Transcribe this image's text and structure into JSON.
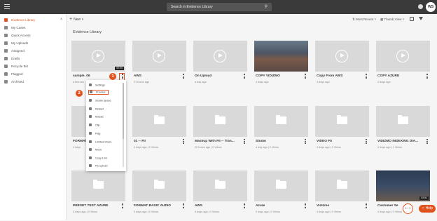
{
  "topbar": {
    "search_placeholder": "Search in Evidence Library",
    "avatar_initials": "WS"
  },
  "sidebar": {
    "items": [
      {
        "label": "Evidence Library",
        "active": true
      },
      {
        "label": "My Cases"
      },
      {
        "label": "Quick Access"
      },
      {
        "label": "My Uploads"
      },
      {
        "label": "Assigned"
      },
      {
        "label": "Drafts"
      },
      {
        "label": "Recycle Bin"
      },
      {
        "label": "Flagged"
      },
      {
        "label": "Archived"
      }
    ]
  },
  "toolbar": {
    "new_label": "New",
    "sort_label": "Most Recent",
    "view_label": "Thumb View"
  },
  "page_title": "Evidence Library",
  "cards": [
    {
      "title": "sample_06",
      "meta": "a few sec",
      "duration": "00:00"
    },
    {
      "title": "AWS",
      "meta": "21 hours ago"
    },
    {
      "title": "On Upload",
      "meta": "a day ago"
    },
    {
      "title": "COPY VIDIZMO",
      "meta": "4 days ago"
    },
    {
      "title": "Copy From AWS",
      "meta": "4 days ago"
    },
    {
      "title": "COPY AZURE",
      "meta": "4 days ago"
    },
    {
      "title": "FORMAT",
      "meta": "4 days"
    },
    {
      "title": "01 -- FII",
      "meta": "4 days ago | 0 Views"
    },
    {
      "title": "Mashup With FII -- Tran...",
      "meta": "20 hours ago | 0 Views"
    },
    {
      "title": "Studio",
      "meta": "a day ago | 0 Views"
    },
    {
      "title": "VIDEO FII",
      "meta": "4 days ago | 0 Views"
    },
    {
      "title": "VIDIZMO INDEXING DIA...",
      "meta": "4 days ago | 1 Views"
    },
    {
      "title": "PRESET TEST AZURE",
      "meta": "3 days ago | 0 Views"
    },
    {
      "title": "FORMAT BASIC AUDIO",
      "meta": "3 days ago | 0 Views"
    },
    {
      "title": "AWS",
      "meta": "4 days ago | 0 Views"
    },
    {
      "title": "Azure",
      "meta": "0 days ago | 0 Views"
    },
    {
      "title": "Vidizmo",
      "meta": "4 days ago | 0 Views"
    },
    {
      "title": "Customer Se",
      "meta": "4 days ago | 0 Views",
      "duration": "03:51"
    }
  ],
  "context_menu": {
    "items": [
      {
        "label": "Settings"
      },
      {
        "label": "Preview",
        "highlighted": true
      },
      {
        "label": "Studio Space"
      },
      {
        "label": "Redact"
      },
      {
        "label": "Mosaic"
      },
      {
        "label": "Clip"
      },
      {
        "label": "Flag"
      },
      {
        "label": "Limited Share"
      },
      {
        "label": "Move"
      },
      {
        "label": "Copy Link"
      },
      {
        "label": "Re-upload"
      }
    ]
  },
  "steps": [
    "1",
    "2"
  ],
  "pager": "1 / 1",
  "help_label": "Help"
}
